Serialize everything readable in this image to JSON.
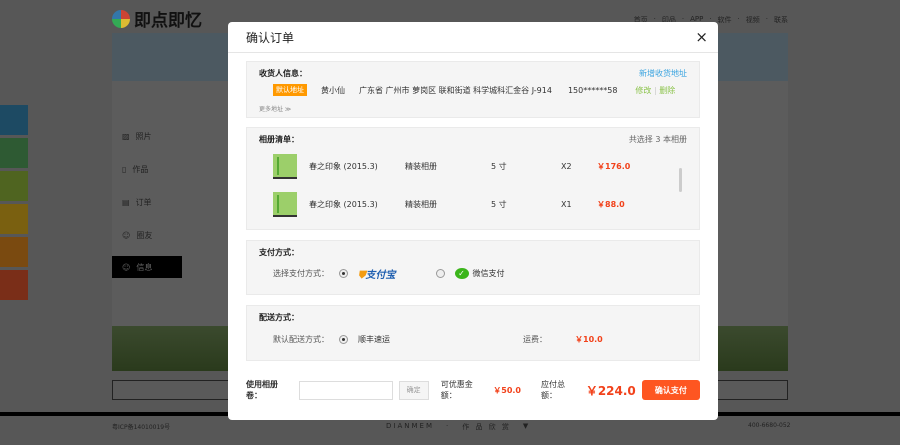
{
  "site": {
    "logo": "即点即忆",
    "nav": [
      "首页",
      "印品",
      "APP",
      "软件",
      "视频",
      "联系"
    ],
    "menu": [
      "照片",
      "作品",
      "订单",
      "圈友",
      "信息"
    ],
    "footer": {
      "icp": "粤ICP备14010019号",
      "brand": "DIANMEM",
      "middle": "作 品 欣 赏",
      "arrow": "▼",
      "phone": "400-6680-052"
    }
  },
  "modal": {
    "title": "确认订单",
    "close": "×",
    "receiver": {
      "heading": "收货人信息：",
      "add_link": "新增收货地址",
      "badge": "默认地址",
      "name": "黄小仙",
      "address": "广东省 广州市 萝岗区 联和街道 科学城科汇金谷 J-914",
      "phone": "150******58",
      "edit": "修改",
      "sep": "|",
      "delete": "删除",
      "more": "更多地址 ≫"
    },
    "albums": {
      "heading": "相册清单：",
      "summary": "共选择 3 本相册",
      "items": [
        {
          "name": "春之印象 (2015.3)",
          "type": "精装相册",
          "size": "5 寸",
          "qty": "X2",
          "price": "￥176.0"
        },
        {
          "name": "春之印象 (2015.3)",
          "type": "精装相册",
          "size": "5 寸",
          "qty": "X1",
          "price": "￥88.0"
        }
      ]
    },
    "payment": {
      "heading": "支付方式：",
      "label": "选择支付方式：",
      "alipay": "支付宝",
      "wechat": "微信支付",
      "selected": "alipay"
    },
    "delivery": {
      "heading": "配送方式：",
      "label": "默认配送方式：",
      "method": "顺丰速运",
      "fee_label": "运费：",
      "fee": "￥10.0"
    },
    "footer": {
      "coupon_label": "使用相册卷：",
      "coupon_value": "",
      "coupon_confirm": "确定",
      "discount_label": "可优惠金额：",
      "discount": "￥50.0",
      "total_label": "应付总额：",
      "total": "￥224.0",
      "submit": "确认支付"
    }
  }
}
